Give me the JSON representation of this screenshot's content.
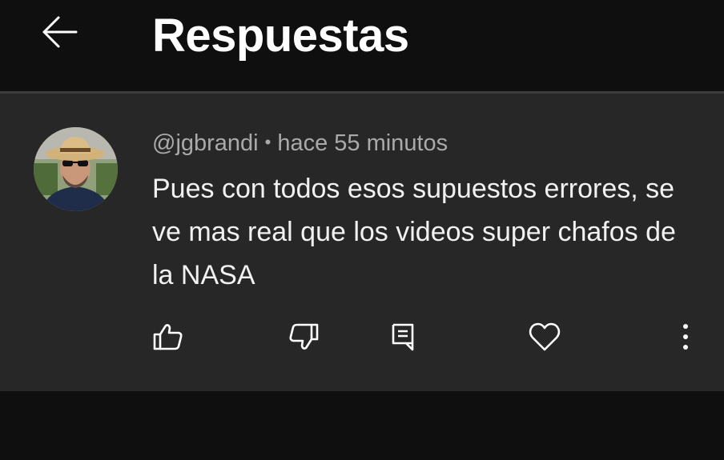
{
  "header": {
    "back_icon": "arrow-left-icon",
    "title": "Respuestas"
  },
  "comment": {
    "author": "@jgbrandi",
    "separator": "•",
    "timestamp": "hace 55 minutos",
    "text": "Pues con todos esos supuestos errores, se ve mas real que los videos super chafos de la NASA",
    "avatar": "user-avatar"
  },
  "actions": [
    {
      "name": "like-button",
      "icon": "thumbs-up-icon"
    },
    {
      "name": "dislike-button",
      "icon": "thumbs-down-icon"
    },
    {
      "name": "reply-button",
      "icon": "comment-icon"
    },
    {
      "name": "heart-button",
      "icon": "heart-icon"
    },
    {
      "name": "more-button",
      "icon": "more-vertical-icon"
    }
  ],
  "colors": {
    "background": "#0f0f0f",
    "card": "#272727",
    "meta_text": "#aaaaaa",
    "text": "#f1f1f1"
  }
}
